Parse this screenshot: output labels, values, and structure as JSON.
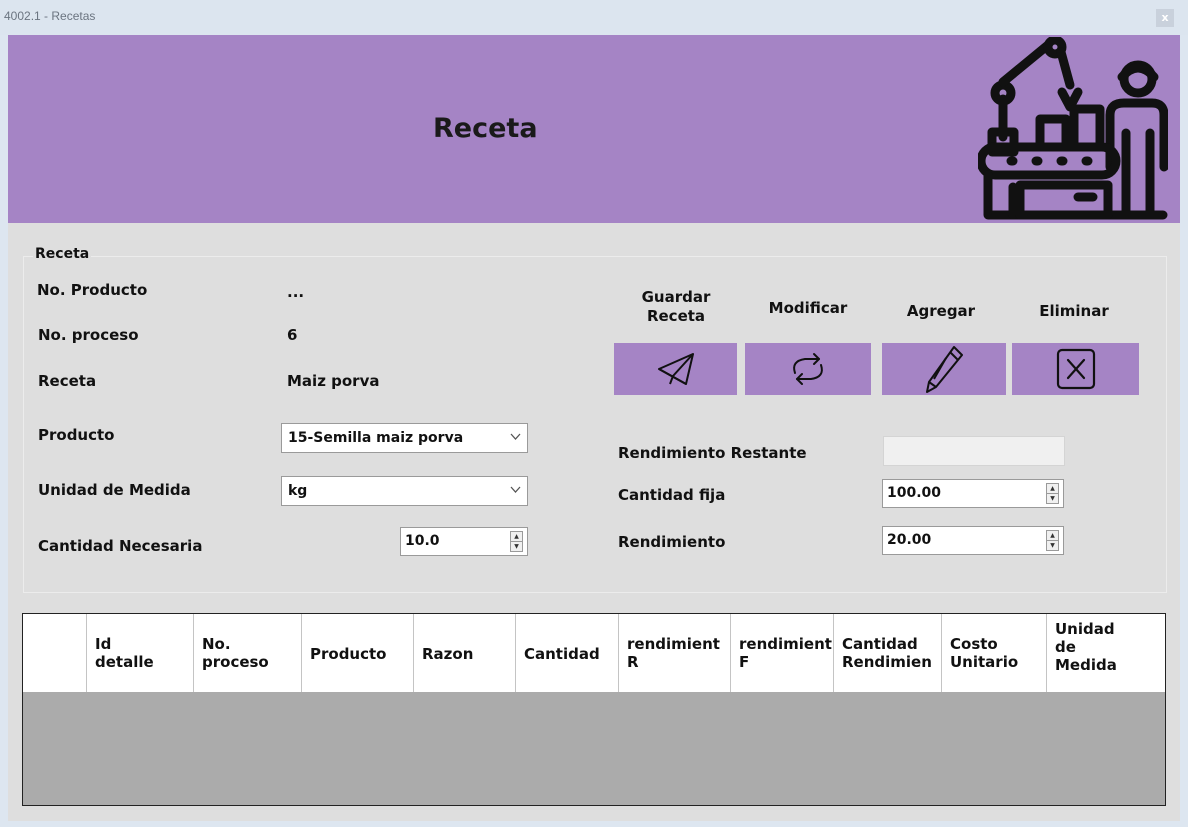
{
  "window": {
    "title": "4002.1 - Recetas",
    "close_label": "x"
  },
  "banner": {
    "title": "Receta",
    "icon": "factory-worker-icon"
  },
  "group": {
    "title": "Receta"
  },
  "form": {
    "no_producto_label": "No. Producto",
    "no_producto_value": "...",
    "no_proceso_label": "No. proceso",
    "no_proceso_value": "6",
    "receta_label": "Receta",
    "receta_value": "Maiz porva",
    "producto_label": "Producto",
    "producto_value": "15-Semilla maiz porva",
    "unidad_label": "Unidad de Medida",
    "unidad_value": "kg",
    "cantidad_label": "Cantidad Necesaria",
    "cantidad_value": "10.0",
    "rend_restante_label": "Rendimiento Restante",
    "rend_restante_value": "",
    "cantidad_fija_label": "Cantidad fija",
    "cantidad_fija_value": "100.00",
    "rendimiento_label": "Rendimiento",
    "rendimiento_value": "20.00"
  },
  "actions": {
    "guardar_label": "Guardar\nReceta",
    "guardar_icon": "send-icon",
    "modificar_label": "Modificar",
    "modificar_icon": "refresh-icon",
    "agregar_label": "Agregar",
    "agregar_icon": "pencil-icon",
    "eliminar_label": "Eliminar",
    "eliminar_icon": "close-box-icon",
    "button_color": "#a584c5"
  },
  "table": {
    "columns": [
      "",
      "Id\ndetalle",
      "No.\nproceso",
      "Producto",
      "Razon",
      "Cantidad",
      "rendimient\nR",
      "rendimient\nF",
      "Cantidad\nRendimien",
      "Costo\nUnitario",
      "Unidad\nde\nMedida"
    ],
    "rows": []
  },
  "colors": {
    "accent": "#a584c5",
    "background": "#dedede",
    "grid_empty": "#ababab"
  }
}
